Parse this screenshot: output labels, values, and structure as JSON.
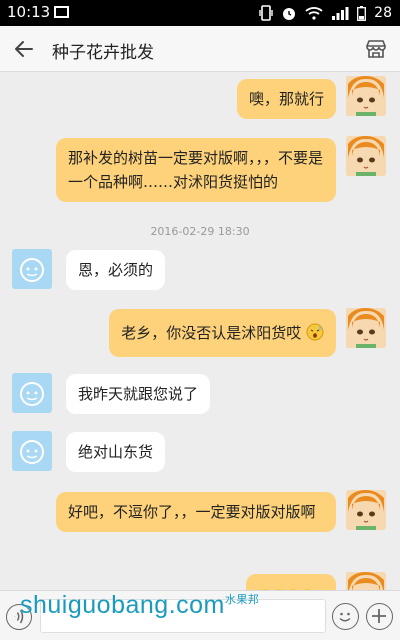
{
  "status": {
    "time": "10:13",
    "battery": "28"
  },
  "header": {
    "title": "种子花卉批发"
  },
  "messages": [
    {
      "from": "me",
      "text": "噢，那就行"
    },
    {
      "from": "me",
      "text": "那补发的树苗一定要对版啊，，，不要是一个品种啊……对沭阳货挺怕的"
    },
    {
      "from": "other",
      "text": "恩，必须的"
    },
    {
      "from": "me",
      "text": "老乡，你没否认是沭阳货哎",
      "emoji": "nervous-sweat-emoji"
    },
    {
      "from": "other",
      "text": "我昨天就跟您说了"
    },
    {
      "from": "other",
      "text": "绝对山东货"
    },
    {
      "from": "me",
      "text": "好吧，不逗你了，，一定要对版对版啊"
    }
  ],
  "timestamp": "2016-02-29 18:30",
  "watermark": {
    "text": "shuiguobang.com",
    "cn": "水果邦"
  },
  "colors": {
    "me_bubble": "#fdd27a",
    "other_bubble": "#ffffff",
    "background": "#ededed"
  }
}
